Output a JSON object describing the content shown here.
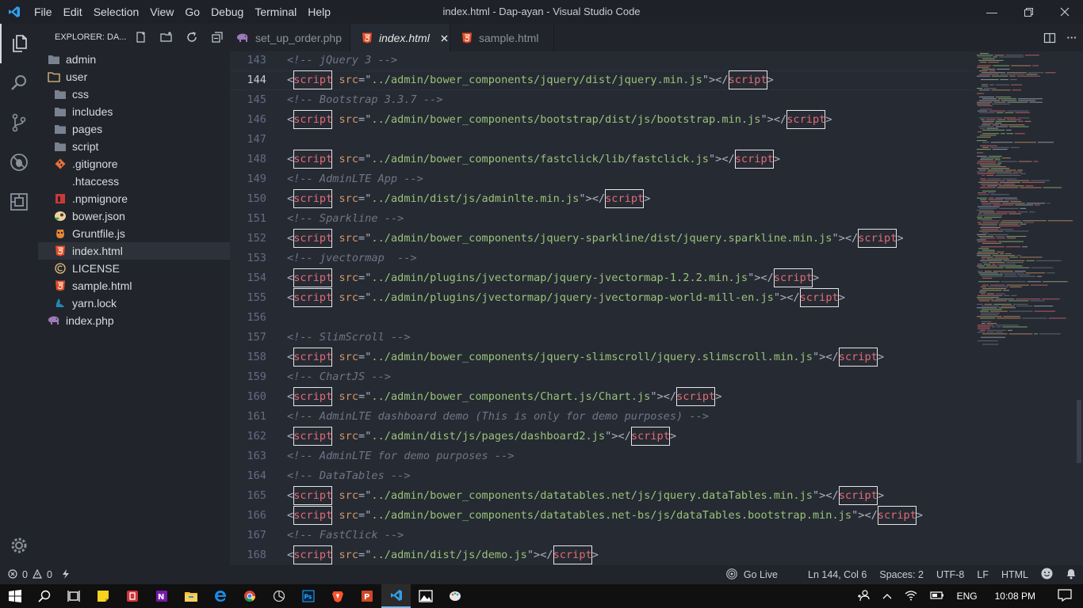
{
  "window": {
    "title": "index.html - Dap-ayan - Visual Studio Code",
    "menu": [
      "File",
      "Edit",
      "Selection",
      "View",
      "Go",
      "Debug",
      "Terminal",
      "Help"
    ]
  },
  "explorer": {
    "title": "EXPLORER: DA...",
    "items": [
      {
        "label": "admin",
        "icon": "folder-icon",
        "indent": 0
      },
      {
        "label": "user",
        "icon": "folder-open-icon",
        "indent": 0
      },
      {
        "label": "css",
        "icon": "folder-icon",
        "indent": 1
      },
      {
        "label": "includes",
        "icon": "folder-icon",
        "indent": 1
      },
      {
        "label": "pages",
        "icon": "folder-icon",
        "indent": 1
      },
      {
        "label": "script",
        "icon": "folder-icon",
        "indent": 1
      },
      {
        "label": ".gitignore",
        "icon": "git-icon",
        "indent": 1
      },
      {
        "label": ".htaccess",
        "icon": "none",
        "indent": 1
      },
      {
        "label": ".npmignore",
        "icon": "npm-icon",
        "indent": 1
      },
      {
        "label": "bower.json",
        "icon": "bower-icon",
        "indent": 1
      },
      {
        "label": "Gruntfile.js",
        "icon": "grunt-icon",
        "indent": 1
      },
      {
        "label": "index.html",
        "icon": "html5-icon",
        "indent": 1,
        "selected": true
      },
      {
        "label": "LICENSE",
        "icon": "copyright-icon",
        "indent": 1
      },
      {
        "label": "sample.html",
        "icon": "html5-icon",
        "indent": 1
      },
      {
        "label": "yarn.lock",
        "icon": "yarn-icon",
        "indent": 1
      },
      {
        "label": "index.php",
        "icon": "php-elephant-icon",
        "indent": 0
      }
    ]
  },
  "tabs": [
    {
      "label": "set_up_order.php",
      "icon": "php-elephant-icon",
      "active": false
    },
    {
      "label": "index.html",
      "icon": "html5-icon",
      "active": true
    },
    {
      "label": "sample.html",
      "icon": "html5-icon",
      "active": false
    }
  ],
  "editor": {
    "current_line": 144,
    "lines": [
      {
        "n": "143",
        "kind": "comment",
        "text": "<!-- jQuery 3 -->"
      },
      {
        "n": "144",
        "kind": "script",
        "src": "../admin/bower_components/jquery/dist/jquery.min.js"
      },
      {
        "n": "145",
        "kind": "comment",
        "text": "<!-- Bootstrap 3.3.7 -->"
      },
      {
        "n": "146",
        "kind": "script",
        "src": "../admin/bower_components/bootstrap/dist/js/bootstrap.min.js"
      },
      {
        "n": "147",
        "kind": "blank"
      },
      {
        "n": "148",
        "kind": "script",
        "src": "../admin/bower_components/fastclick/lib/fastclick.js"
      },
      {
        "n": "149",
        "kind": "comment",
        "text": "<!-- AdminLTE App -->"
      },
      {
        "n": "150",
        "kind": "script",
        "src": "../admin/dist/js/adminlte.min.js"
      },
      {
        "n": "151",
        "kind": "comment",
        "text": "<!-- Sparkline -->"
      },
      {
        "n": "152",
        "kind": "script",
        "src": "../admin/bower_components/jquery-sparkline/dist/jquery.sparkline.min.js"
      },
      {
        "n": "153",
        "kind": "comment",
        "text": "<!-- jvectormap  -->"
      },
      {
        "n": "154",
        "kind": "script",
        "src": "../admin/plugins/jvectormap/jquery-jvectormap-1.2.2.min.js"
      },
      {
        "n": "155",
        "kind": "script",
        "src": "../admin/plugins/jvectormap/jquery-jvectormap-world-mill-en.js"
      },
      {
        "n": "156",
        "kind": "blank"
      },
      {
        "n": "157",
        "kind": "comment",
        "text": "<!-- SlimScroll -->"
      },
      {
        "n": "158",
        "kind": "script",
        "src": "../admin/bower_components/jquery-slimscroll/jquery.slimscroll.min.js"
      },
      {
        "n": "159",
        "kind": "comment",
        "text": "<!-- ChartJS -->"
      },
      {
        "n": "160",
        "kind": "script",
        "src": "../admin/bower_components/Chart.js/Chart.js"
      },
      {
        "n": "161",
        "kind": "comment",
        "text": "<!-- AdminLTE dashboard demo (This is only for demo purposes) -->"
      },
      {
        "n": "162",
        "kind": "script",
        "src": "../admin/dist/js/pages/dashboard2.js"
      },
      {
        "n": "163",
        "kind": "comment",
        "text": "<!-- AdminLTE for demo purposes -->"
      },
      {
        "n": "164",
        "kind": "comment",
        "text": "<!-- DataTables -->"
      },
      {
        "n": "165",
        "kind": "script",
        "src": "../admin/bower_components/datatables.net/js/jquery.dataTables.min.js"
      },
      {
        "n": "166",
        "kind": "script",
        "src": "../admin/bower_components/datatables.net-bs/js/dataTables.bootstrap.min.js"
      },
      {
        "n": "167",
        "kind": "comment",
        "text": "<!-- FastClick -->"
      },
      {
        "n": "168",
        "kind": "script",
        "src": "../admin/dist/js/demo.js"
      }
    ]
  },
  "statusbar": {
    "errors": "0",
    "warnings": "0",
    "go_live": "Go Live",
    "position": "Ln 144, Col 6",
    "spaces": "Spaces: 2",
    "encoding": "UTF-8",
    "eol": "LF",
    "language": "HTML"
  },
  "taskbar": {
    "language": "ENG",
    "time": "10:08 PM"
  }
}
